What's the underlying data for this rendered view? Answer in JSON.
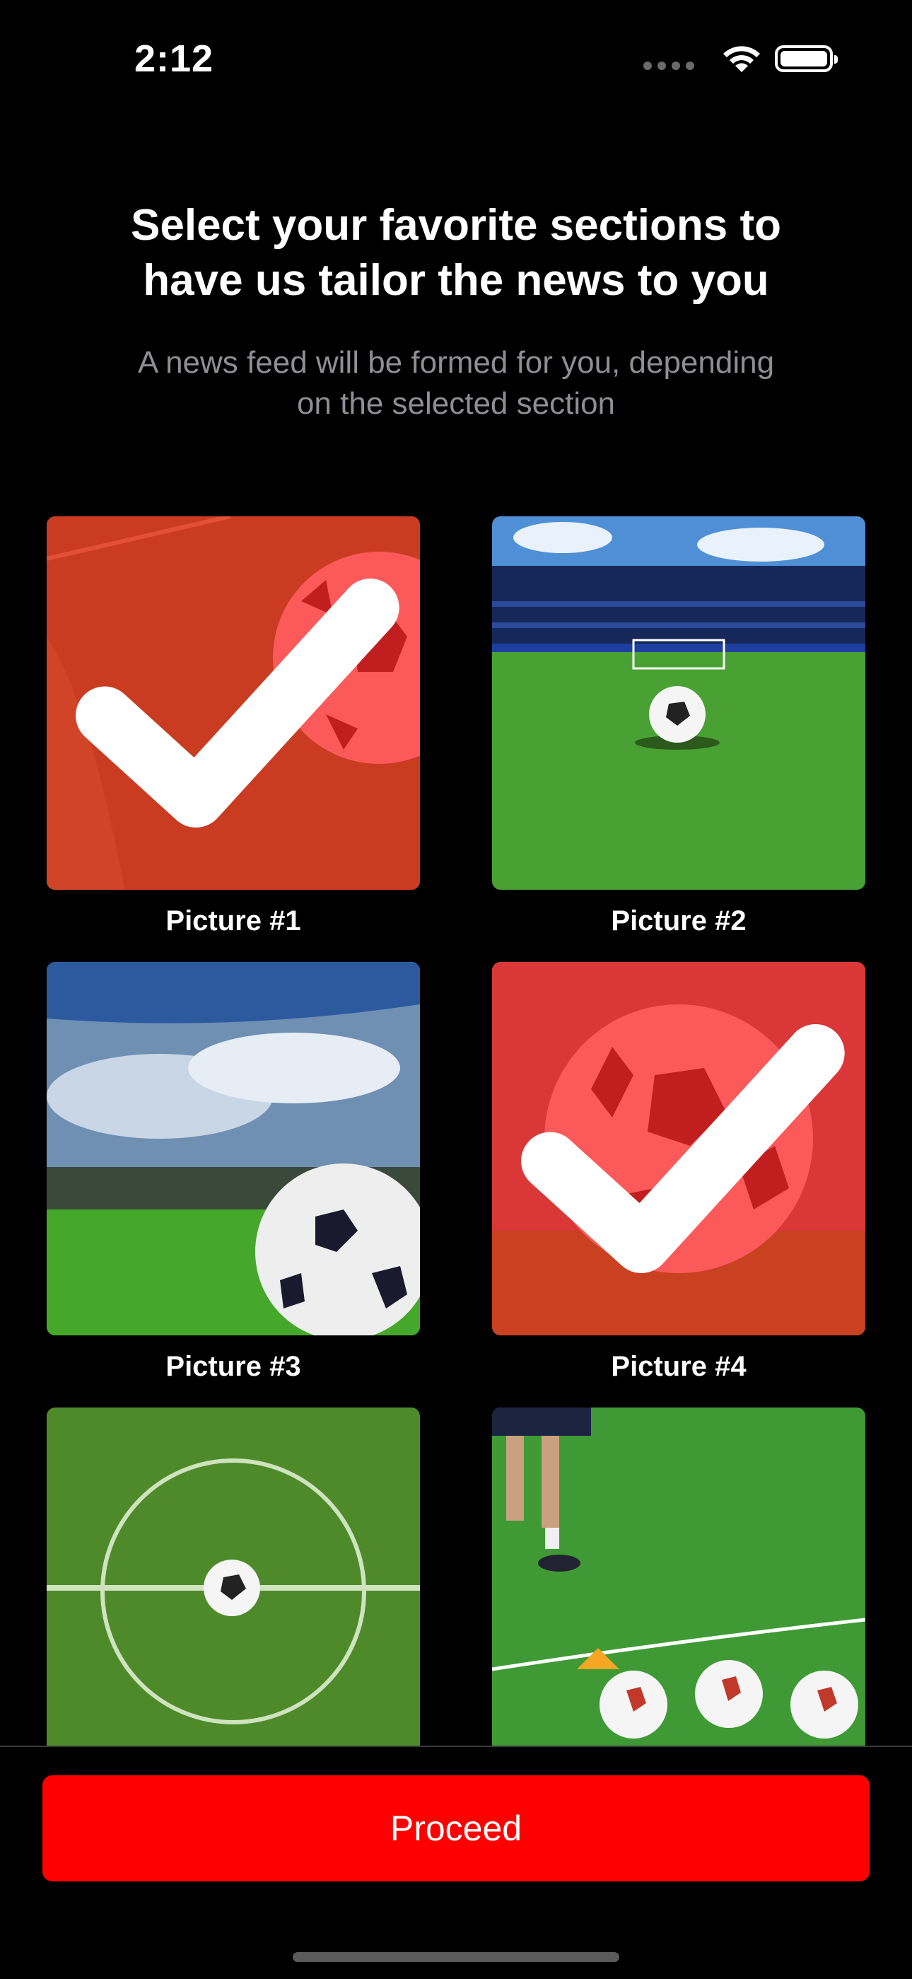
{
  "status_bar": {
    "time": "2:12",
    "icons": [
      "signal-dots-icon",
      "wifi-icon",
      "battery-icon"
    ]
  },
  "header": {
    "title_line1": "Select your favorite sections to",
    "title_line2": "have us tailor the news to you",
    "subtitle_line1": "A news feed will be formed for you, depending",
    "subtitle_line2": "on the selected section"
  },
  "grid": {
    "items": [
      {
        "label": "Picture #1",
        "selected": true
      },
      {
        "label": "Picture #2",
        "selected": false
      },
      {
        "label": "Picture #3",
        "selected": false
      },
      {
        "label": "Picture #4",
        "selected": true
      },
      {
        "label": "",
        "selected": false
      },
      {
        "label": "",
        "selected": false
      }
    ]
  },
  "footer": {
    "proceed_label": "Proceed"
  },
  "colors": {
    "accent": "#ff0000",
    "selection_overlay": "#ff1e1e",
    "background": "#000000",
    "subtitle": "#8e8e93"
  }
}
